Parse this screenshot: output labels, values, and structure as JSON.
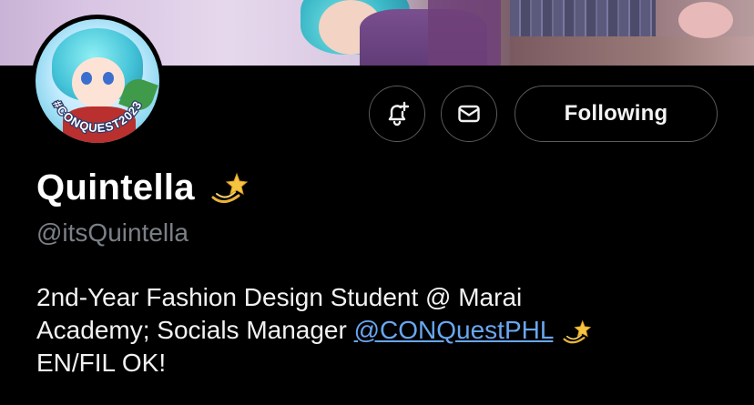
{
  "profile": {
    "display_name": "Quintella",
    "handle": "@itsQuintella",
    "name_emoji": "dizzy-star-emoji",
    "avatar_badge_text": "#CONQUEST2023"
  },
  "actions": {
    "notify_icon": "bell-plus-icon",
    "message_icon": "envelope-icon",
    "following_label": "Following"
  },
  "bio": {
    "line1": "2nd-Year Fashion Design Student @ Marai",
    "line2_prefix": "Academy; Socials Manager ",
    "mention": "@CONQuestPHL",
    "line3": "EN/FIL OK!"
  },
  "colors": {
    "background": "#000000",
    "muted_text": "#7b8087",
    "link": "#69a7f0",
    "button_border": "#5a5a5a"
  }
}
